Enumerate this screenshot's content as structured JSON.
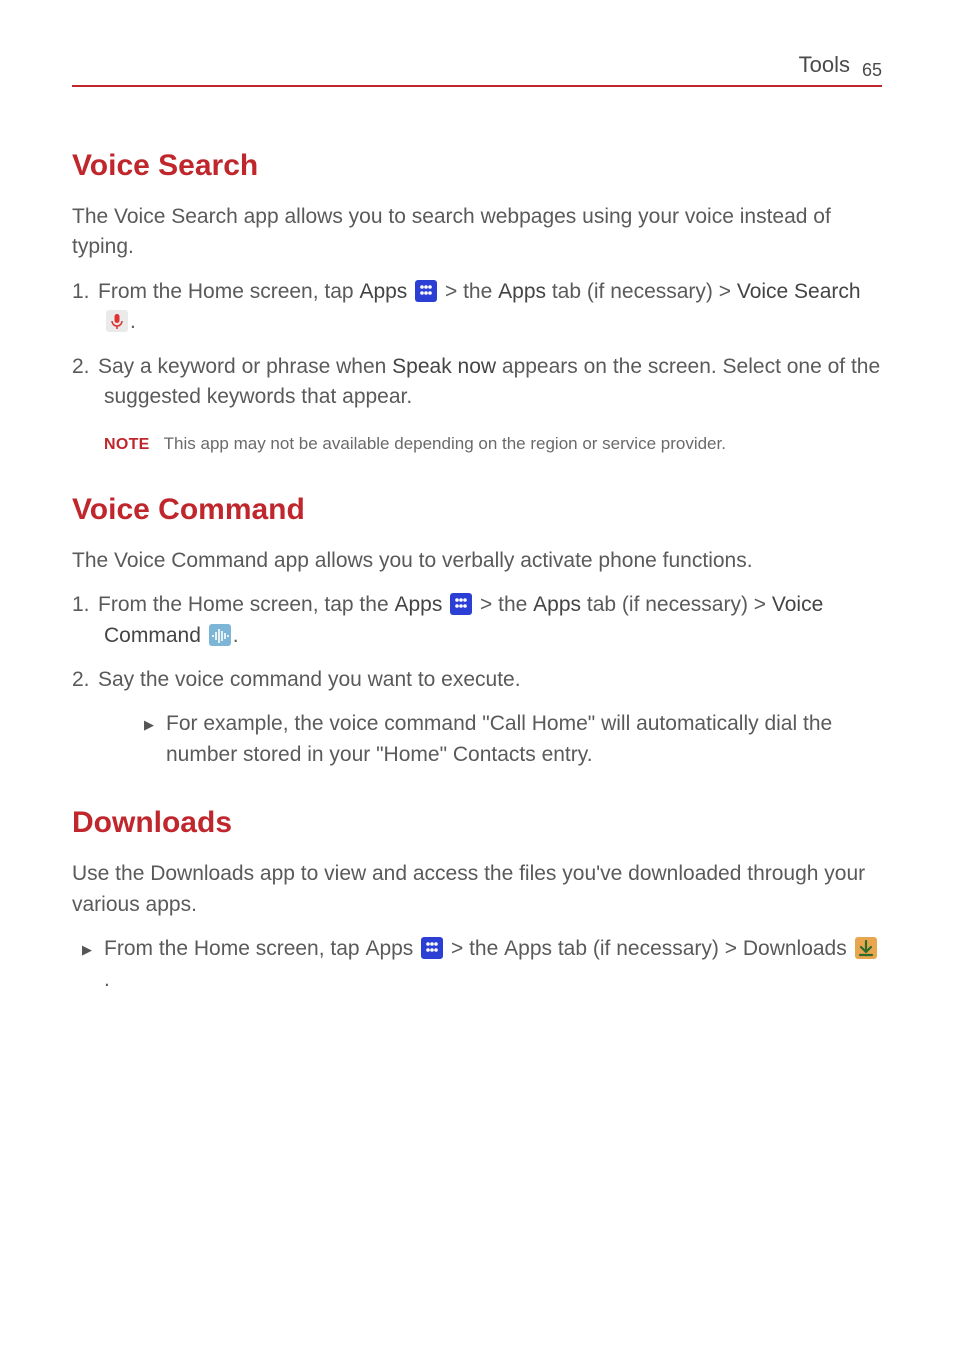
{
  "header": {
    "title": "Tools",
    "page": "65"
  },
  "sections": {
    "voice_search": {
      "heading": "Voice Search",
      "intro": "The Voice Search app allows you to search webpages using your voice instead of typing.",
      "step1_pre": "From the Home screen, tap ",
      "step1_apps": "Apps",
      "step1_mid1": " > the ",
      "step1_appsTab": "Apps",
      "step1_mid2": " tab (if necessary) > ",
      "step1_vs": "Voice Search",
      "step1_end": ".",
      "step2_pre": "Say a keyword or phrase when ",
      "step2_speak": "Speak now",
      "step2_post": " appears on the screen. Select one of the suggested keywords that appear.",
      "note_label": "NOTE",
      "note_text": "This app may not be available depending on the region or service provider."
    },
    "voice_command": {
      "heading": "Voice Command",
      "intro": "The Voice Command app allows you to verbally activate phone functions.",
      "step1_pre": "From the Home screen, tap the ",
      "step1_apps": "Apps",
      "step1_mid1": " > the ",
      "step1_appsTab": "Apps",
      "step1_mid2": " tab (if necessary) > ",
      "step1_vc": "Voice Command",
      "step1_end": ".",
      "step2": "Say the voice command you want to execute.",
      "sub": "For example, the voice command \"Call Home\" will automatically dial the number stored in your \"Home\" Contacts entry."
    },
    "downloads": {
      "heading": "Downloads",
      "intro": "Use the Downloads app to view and access the files you've downloaded through your various apps.",
      "bullet_pre": "From the Home screen, tap ",
      "bullet_apps": "Apps",
      "bullet_mid1": " > the ",
      "bullet_appsTab": "Apps",
      "bullet_mid2": " tab (if necessary) > ",
      "bullet_dl": "Downloads",
      "bullet_end": "."
    }
  },
  "glyphs": {
    "triangle": "▶"
  }
}
